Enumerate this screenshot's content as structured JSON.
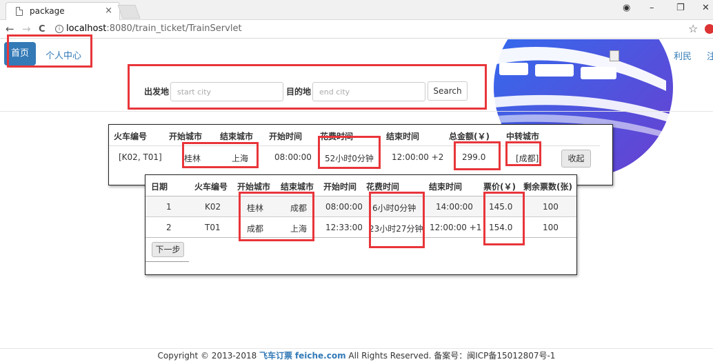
{
  "browser": {
    "tab_title": "package",
    "tab_close": "×",
    "url_host": "localhost",
    "url_path": ":8080/train_ticket/TrainServlet",
    "win_min": "–",
    "win_max": "❐",
    "win_close": "✕",
    "back": "←",
    "forward": "→",
    "reload": "C",
    "info": "i",
    "star": "☆",
    "account_icon": "◉"
  },
  "nav": {
    "home": "首页",
    "profile": "个人中心",
    "user_name": "利民",
    "user_link2": "注"
  },
  "search": {
    "from_label": "出发地",
    "from_placeholder": "start city",
    "to_label": "目的地",
    "to_placeholder": "end city",
    "button": "Search"
  },
  "results": {
    "headers": [
      "火车编号",
      "开始城市",
      "结束城市",
      "开始时间",
      "花费时间",
      "结束时间",
      "总金额(￥)",
      "中转城市"
    ],
    "row": {
      "train": "[K02, T01]",
      "start_city": "桂林",
      "end_city": "上海",
      "start_time": "08:00:00",
      "duration": "52小时0分钟",
      "end_time": "12:00:00 +2",
      "total": "299.0",
      "transfer": "[成都]"
    },
    "collapse_button": "收起"
  },
  "detail": {
    "headers": [
      "日期",
      "火车编号",
      "开始城市",
      "结束城市",
      "开始时间",
      "花费时间",
      "结束时间",
      "票价(￥)",
      "剩余票数(张)"
    ],
    "rows": [
      {
        "day": "1",
        "train": "K02",
        "start_city": "桂林",
        "end_city": "成都",
        "start_time": "08:00:00",
        "duration": "6小时0分钟",
        "end_time": "14:00:00",
        "price": "145.0",
        "remaining": "100"
      },
      {
        "day": "2",
        "train": "T01",
        "start_city": "成都",
        "end_city": "上海",
        "start_time": "12:33:00",
        "duration": "23小时27分钟",
        "end_time": "12:00:00 +1",
        "price": "154.0",
        "remaining": "100"
      }
    ],
    "next_button": "下一步"
  },
  "footer": {
    "prefix": "Copyright © 2013-2018",
    "brand": "飞车订票",
    "site": "feiche.com",
    "suffix": "All Rights Reserved. 备案号：闽ICP备15012807号-1"
  },
  "colors": {
    "primary": "#337ab7",
    "annotation": "#e8353a",
    "banner_blue": "#2d6ff0",
    "banner_purple": "#6a3fd0"
  }
}
